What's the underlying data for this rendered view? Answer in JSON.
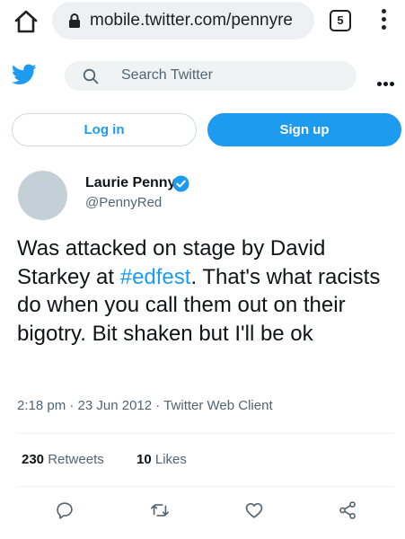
{
  "browser": {
    "url": "mobile.twitter.com/pennyre",
    "tab_count": "5"
  },
  "header": {
    "search_placeholder": "Search Twitter"
  },
  "auth": {
    "login_label": "Log in",
    "signup_label": "Sign up"
  },
  "tweet": {
    "display_name": "Laurie Penny",
    "handle": "@PennyRed",
    "text_before": "Was attacked on stage by David Starkey at ",
    "hashtag": "#edfest",
    "text_after": ". That's what racists do when you call them out on their bigotry. Bit shaken but I'll be ok",
    "time": "2:18 pm",
    "date": "23 Jun 2012",
    "client": "Twitter Web Client",
    "retweets_count": "230",
    "retweets_label": "Retweets",
    "likes_count": "10",
    "likes_label": "Likes"
  },
  "colors": {
    "accent": "#1d9bf0",
    "text": "#0f1419",
    "muted": "#536471"
  },
  "icons": [
    "home-icon",
    "lock-icon",
    "tabs-icon",
    "kebab-menu-icon",
    "twitter-bird-icon",
    "search-icon",
    "more-icon",
    "verified-icon",
    "reply-icon",
    "retweet-icon",
    "like-icon",
    "share-icon"
  ]
}
